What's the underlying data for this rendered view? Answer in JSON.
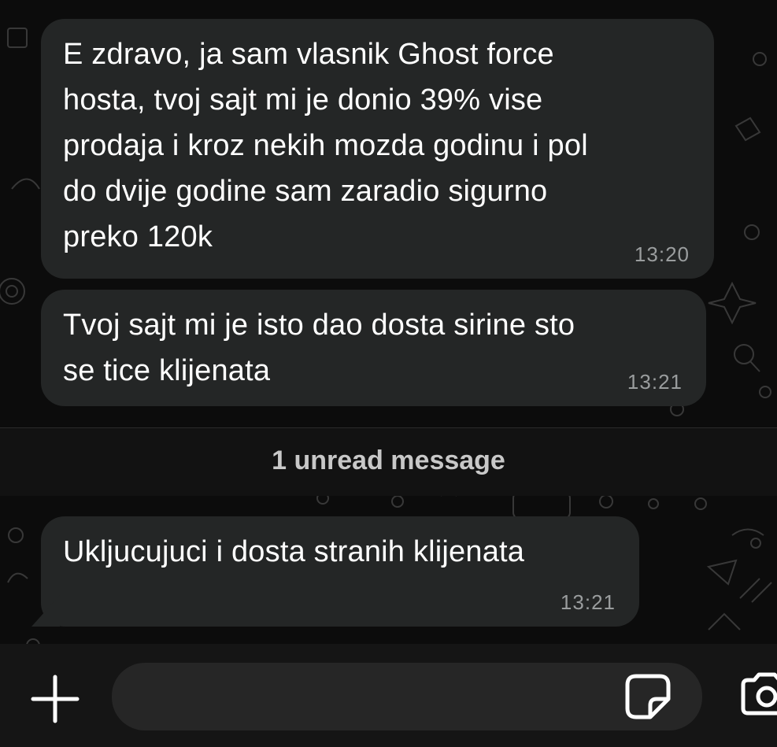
{
  "messages": [
    {
      "text": "E zdravo, ja sam vlasnik Ghost force\nhosta, tvoj sajt mi je donio 39% vise\nprodaja i kroz nekih mozda godinu i pol\ndo dvije godine sam zaradio sigurno\npreko 120k",
      "time": "13:20"
    },
    {
      "text": "Tvoj sajt mi je isto dao dosta sirine sto\nse tice klijenata",
      "time": "13:21"
    },
    {
      "text": "Ukljucujuci i dosta stranih klijenata",
      "time": "13:21"
    }
  ],
  "divider": {
    "label": "1 unread message"
  },
  "input": {
    "placeholder": "",
    "icons": {
      "attach": "plus-icon",
      "sticker": "sticker-icon",
      "camera": "camera-icon"
    }
  },
  "colors": {
    "background": "#0c0c0c",
    "bubble": "#242626",
    "timestamp": "#9a9d9e",
    "divider_text": "#c8c8c8"
  }
}
